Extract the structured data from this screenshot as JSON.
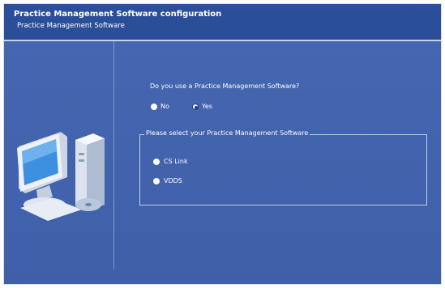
{
  "header": {
    "title": "Practice Management Software configuration",
    "subtitle": "Practice Management Software"
  },
  "question": {
    "label": "Do you use a Practice Management Software?",
    "options": [
      {
        "label": "No",
        "selected": false
      },
      {
        "label": "Yes",
        "selected": true
      }
    ]
  },
  "software_group": {
    "label": "Please select your Practice Management Software",
    "options": [
      {
        "label": "CS Link",
        "selected": false
      },
      {
        "label": "VDDS",
        "selected": false
      }
    ]
  },
  "icons": {
    "illustration": "computer-icon"
  },
  "colors": {
    "background": "#3d5fa8",
    "header": "#2c4f9b"
  }
}
